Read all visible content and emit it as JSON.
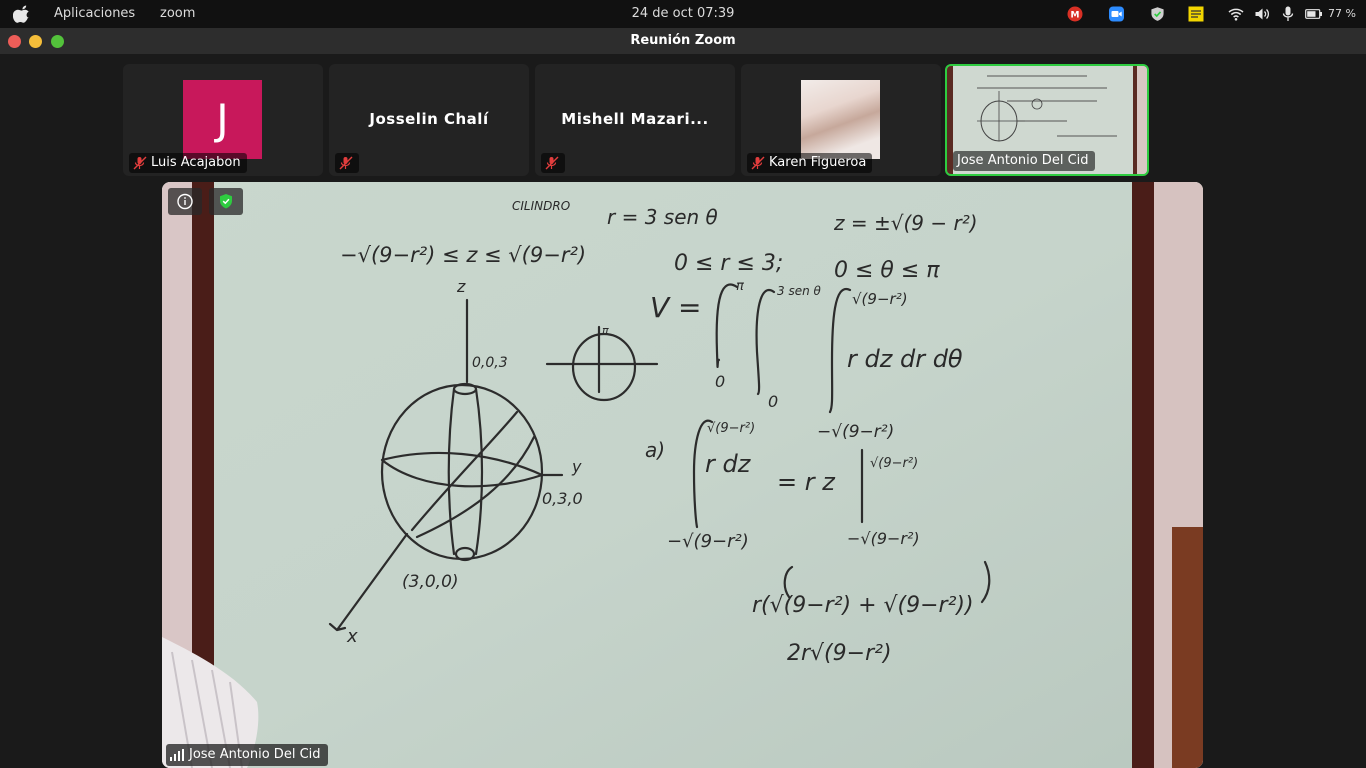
{
  "topbar": {
    "menu_apps": "Aplicaciones",
    "menu_zoom": "zoom",
    "clock": "24 de oct  07:39",
    "battery": "77 %"
  },
  "window": {
    "title": "Reunión Zoom"
  },
  "participants": [
    {
      "name": "Luis Acajabon",
      "initial": "J",
      "muted": true,
      "avatar_color": "#c8185b"
    },
    {
      "name": "Josselin Chalí",
      "muted": true
    },
    {
      "name": "Mishell Mazari...",
      "muted": true
    },
    {
      "name": "Karen Figueroa",
      "muted": true
    },
    {
      "name": "Jose Antonio Del Cid",
      "muted": false,
      "active_speaker": true
    }
  ],
  "main_video": {
    "speaker_name": "Jose Antonio Del Cid",
    "whiteboard": {
      "label_cilindro": "CILINDRO",
      "eq_r": "r = 3 sen θ",
      "eq_z": "z = ±√(9 − r²)",
      "ineq_z": "−√(9−r²) ≤ z ≤ √(9−r²)",
      "ineq_r": "0 ≤ r ≤ 3;",
      "ineq_theta": "0 ≤ θ ≤ π",
      "axis_z": "z",
      "point_003": "0,0,3",
      "axis_y": "y",
      "point_030": "0,3,0",
      "point_300": "(3,0,0)",
      "axis_x": "x",
      "pi_mark": "π",
      "volume_v": "V =",
      "int_upper_pi": "π",
      "int_lower_0a": "0",
      "int_upper_3sen": "3 sen θ",
      "int_lower_0b": "0",
      "int_upper_sqrt": "√(9−r²)",
      "integrand": "r dz dr dθ",
      "int_lower_negsqrt": "−√(9−r²)",
      "part_a": "a)",
      "a_upper": "√(9−r²)",
      "a_integrand": "r dz",
      "a_equals": "= r z",
      "a_eval_upper": "√(9−r²)",
      "a_lower": "−√(9−r²)",
      "a_eval_lower": "−√(9−r²)",
      "step1": "r(√(9−r²) + √(9−r²))",
      "step2": "2r√(9−r²)"
    }
  },
  "colors": {
    "active_border": "#2ecc40",
    "muted_icon": "#e23d3d",
    "secure_icon": "#2ecc40"
  }
}
